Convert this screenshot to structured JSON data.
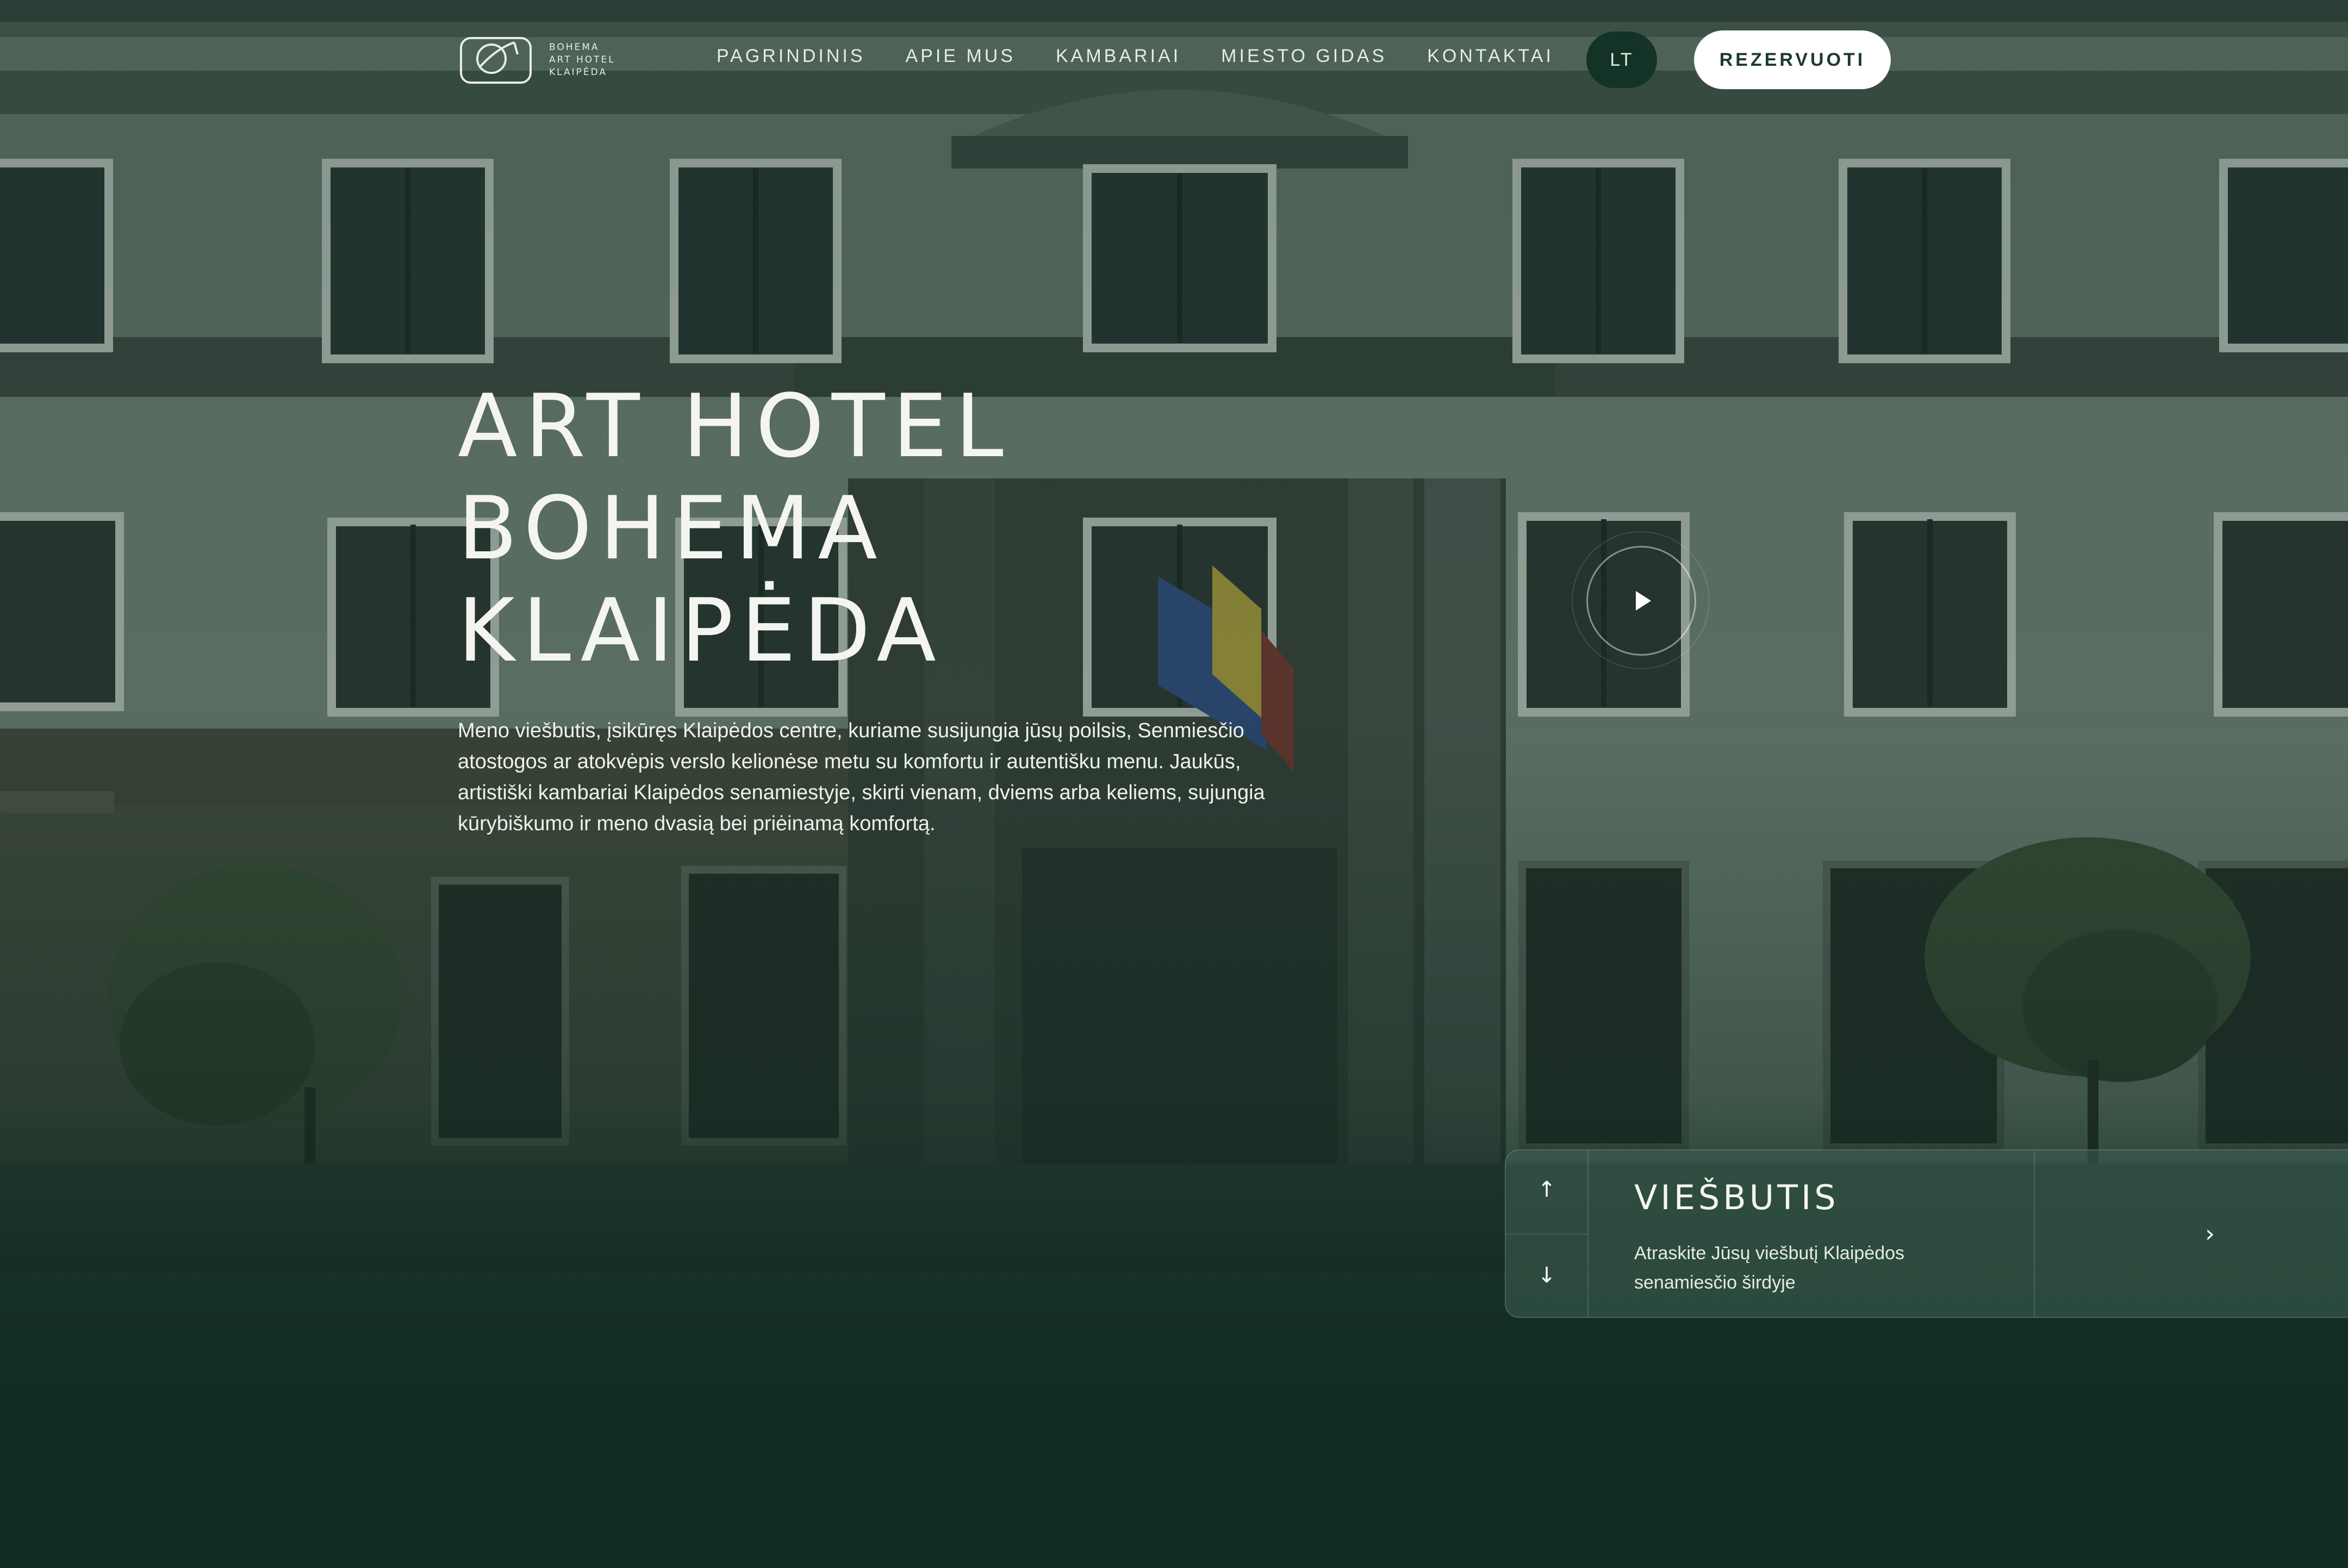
{
  "brand": {
    "logo_lines": [
      "BOHEMA",
      "ART HOTEL",
      "KLAIPĖDA"
    ]
  },
  "nav": {
    "items": [
      "PAGRINDINIS",
      "APIE MUS",
      "KAMBARIAI",
      "MIESTO GIDAS",
      "KONTAKTAI"
    ]
  },
  "header": {
    "language": "LT",
    "reserve_label": "REZERVUOTI"
  },
  "hero": {
    "title_lines": [
      "ART HOTEL",
      "BOHEMA",
      "KLAIPĖDA"
    ],
    "description": "Meno viešbutis, įsikūręs Klaipėdos centre, kuriame susijungia jūsų poilsis, Senmiesčio atostogos ar atokvėpis verslo kelionėse metu su komfortu ir autentišku menu. Jaukūs, artistiški kambariai Klaipėdos senamiestyje, skirti vienam, dviems arba keliems, sujungia kūrybiškumo ir meno dvasią bei priėinamą komfortą."
  },
  "feature_card": {
    "title": "VIEŠBUTIS",
    "description": "Atraskite Jūsų viešbutį Klaipėdos senamiesčio širdyje",
    "icons": [
      "arrow-up-icon",
      "arrow-down-icon",
      "chevron-right-icon",
      "play-icon"
    ]
  },
  "colors": {
    "background": "#112c22",
    "overlay": "#0e281e",
    "reserve_button": "#ffffff",
    "language_button": "#123326",
    "card": "#3a5c4d"
  }
}
